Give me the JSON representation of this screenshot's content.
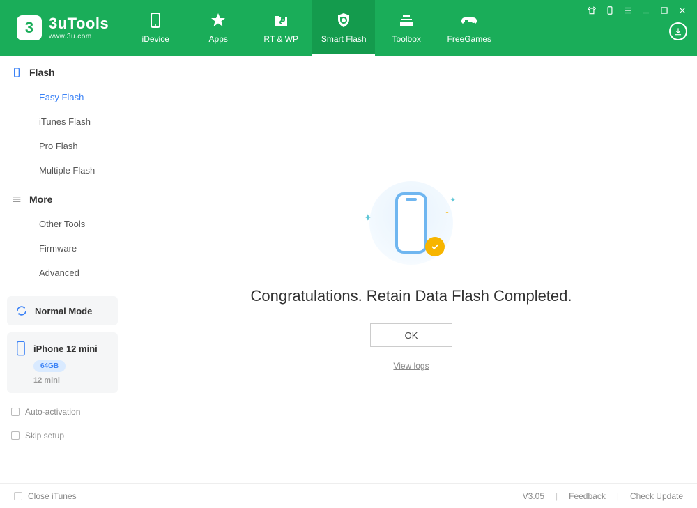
{
  "app": {
    "title": "3uTools",
    "subtitle": "www.3u.com"
  },
  "tabs": [
    {
      "key": "idevice",
      "label": "iDevice"
    },
    {
      "key": "apps",
      "label": "Apps"
    },
    {
      "key": "rtwp",
      "label": "RT & WP"
    },
    {
      "key": "smartflash",
      "label": "Smart Flash"
    },
    {
      "key": "toolbox",
      "label": "Toolbox"
    },
    {
      "key": "freegames",
      "label": "FreeGames"
    }
  ],
  "sidebar": {
    "section1": {
      "title": "Flash",
      "items": [
        "Easy Flash",
        "iTunes Flash",
        "Pro Flash",
        "Multiple Flash"
      ]
    },
    "section2": {
      "title": "More",
      "items": [
        "Other Tools",
        "Firmware",
        "Advanced"
      ]
    },
    "mode": "Normal Mode",
    "device": {
      "name": "iPhone 12 mini",
      "storage": "64GB",
      "model": "12 mini"
    },
    "checks": [
      "Auto-activation",
      "Skip setup"
    ]
  },
  "main": {
    "headline": "Congratulations. Retain Data Flash Completed.",
    "ok": "OK",
    "viewlogs": "View logs"
  },
  "status": {
    "closeitunes": "Close iTunes",
    "version": "V3.05",
    "feedback": "Feedback",
    "update": "Check Update"
  }
}
